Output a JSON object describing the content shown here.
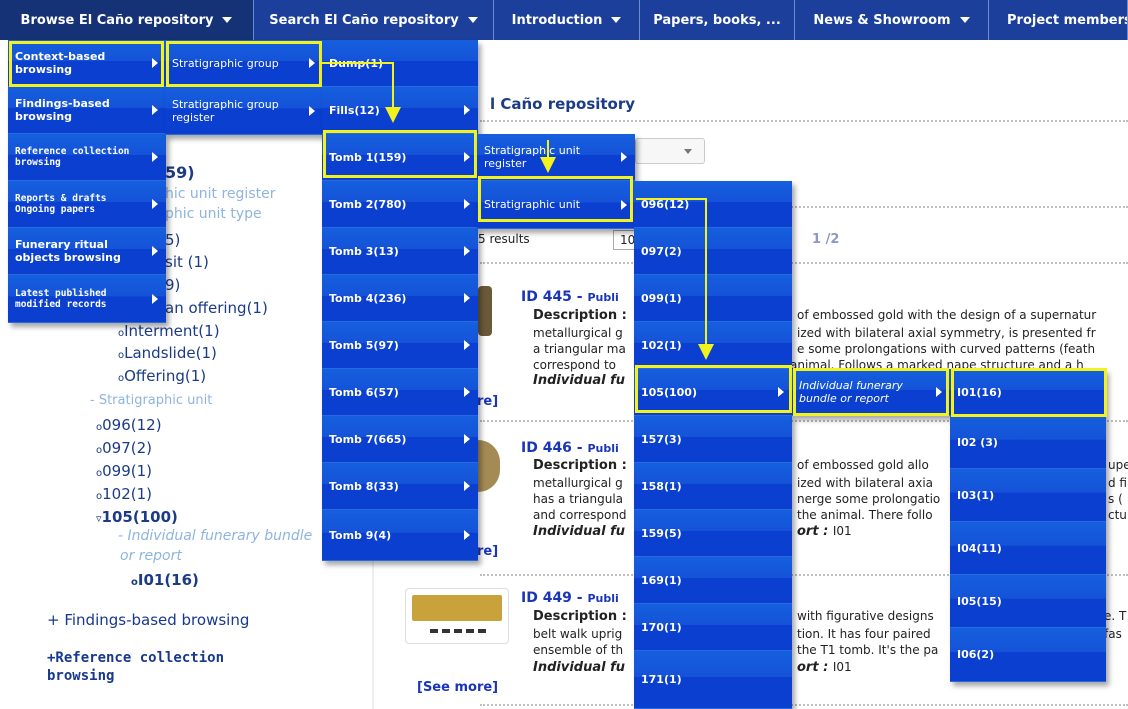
{
  "topnav": [
    {
      "label": "Browse El Caño repository",
      "active": true
    },
    {
      "label": "Search El Caño repository"
    },
    {
      "label": "Introduction"
    },
    {
      "label": "Papers, books, ..."
    },
    {
      "label": "News & Showroom"
    },
    {
      "label": "Project members"
    }
  ],
  "page": {
    "title": "l Caño repository",
    "count": "59)",
    "unit_register": "hic unit register",
    "unit_type": "phic unit type",
    "n5": "5)",
    "sit": "sit (1)",
    "n9": "9)",
    "offering": "an offering(1)",
    "interment": "Interment(1)",
    "landslide": "Landslide(1)",
    "offering2": "Offering(1)",
    "strat_unit": "- Stratigraphic unit",
    "u096": "096(12)",
    "u097": "097(2)",
    "u099": "099(1)",
    "u102": "102(1)",
    "u105": "105(100)",
    "bundle1": "- Individual funerary bundle",
    "bundle2": "or report",
    "i01": "I01(16)",
    "findings": "+ Findings-based browsing",
    "reference1": "+Reference collection",
    "reference2": "browsing",
    "results": "5 results",
    "perpage": "10",
    "pages": "1 /2",
    "see_more1": "re]",
    "see_more2": "re]",
    "see_more3": "[See more]",
    "r1_id": "ID 445",
    "r1_pub": "Publi",
    "r1_desc": "Description :",
    "r1_l2": "metallurgical g",
    "r1_l3": "a triangular ma",
    "r1_l4": "correspond to",
    "r1_l5": "Individual fu",
    "r1_c1": "of embossed gold with the design of a supernatur",
    "r1_c2": "ized with bilateral axial symmetry, is presented fr",
    "r1_c3": "e some prolongations with curved patterns (feath",
    "r1_c4": "animal. Follows a marked nape structure and a h",
    "r2_id": "ID 446",
    "r2_pub": "Publi",
    "r2_desc": "Description :",
    "r2_l2": "metallurgical g",
    "r2_l3": "has a triangula",
    "r2_l4": "and correspond",
    "r2_l5": "Individual fu",
    "r2_c1": "of embossed gold allo",
    "r2_c2": "ized with bilateral axia",
    "r2_c3": "nerge some prolongatio",
    "r2_c4": "the animal. There follo",
    "r2_c5": "ort :",
    "r2_c6": "I01",
    "r2_e1": "upe",
    "r2_e2": "d fi",
    "r2_e3": "s (",
    "r2_e4": "ctu",
    "r3_id": "ID 449",
    "r3_pub": "Publi",
    "r3_desc": "Description :",
    "r3_l2": "belt walk uprig",
    "r3_l3": "ensemble of th",
    "r3_l4": "Individual fu",
    "r3_c1": "with figurative designs",
    "r3_c2": "tion. It has four paired",
    "r3_c3": "the T1 tomb. It's the pa",
    "r3_c4": "ort :",
    "r3_c5": "I01",
    "r3_e1": "e. T",
    "r3_e2": "fas"
  },
  "menu1": [
    "Context-based browsing",
    "Findings-based browsing",
    "Reference collection browsing",
    "Reports & drafts Ongoing papers",
    "Funerary ritual objects browsing",
    "Latest published modified records"
  ],
  "menu2": [
    "Stratigraphic group",
    "Stratigraphic group register"
  ],
  "menu3": [
    "Dump(1)",
    "Fills(12)",
    "Tomb 1(159)",
    "Tomb 2(780)",
    "Tomb 3(13)",
    "Tomb 4(236)",
    "Tomb 5(97)",
    "Tomb 6(57)",
    "Tomb 7(665)",
    "Tomb 8(33)",
    "Tomb 9(4)"
  ],
  "menu4": [
    "Stratigraphic unit register",
    "Stratigraphic unit"
  ],
  "menu5": [
    "096(12)",
    "097(2)",
    "099(1)",
    "102(1)",
    "105(100)",
    "157(3)",
    "158(1)",
    "159(5)",
    "169(1)",
    "170(1)",
    "171(1)"
  ],
  "menu6": [
    "Individual funerary bundle or report"
  ],
  "menu7": [
    "I01(16)",
    "I02 (3)",
    "I03(1)",
    "I04(11)",
    "I05(15)",
    "I06(2)"
  ],
  "colors": {
    "nav": "#1b3f9a",
    "menu": "#0a3fd0",
    "highlight": "#f2f21d"
  }
}
